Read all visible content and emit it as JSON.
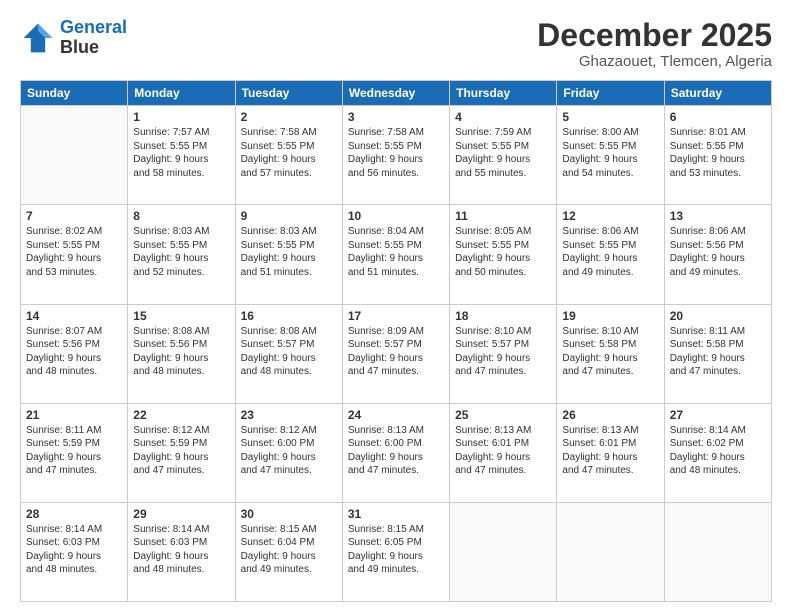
{
  "header": {
    "logo_line1": "General",
    "logo_line2": "Blue",
    "month": "December 2025",
    "location": "Ghazaouet, Tlemcen, Algeria"
  },
  "days_of_week": [
    "Sunday",
    "Monday",
    "Tuesday",
    "Wednesday",
    "Thursday",
    "Friday",
    "Saturday"
  ],
  "weeks": [
    [
      {
        "day": "",
        "info": ""
      },
      {
        "day": "1",
        "info": "Sunrise: 7:57 AM\nSunset: 5:55 PM\nDaylight: 9 hours\nand 58 minutes."
      },
      {
        "day": "2",
        "info": "Sunrise: 7:58 AM\nSunset: 5:55 PM\nDaylight: 9 hours\nand 57 minutes."
      },
      {
        "day": "3",
        "info": "Sunrise: 7:58 AM\nSunset: 5:55 PM\nDaylight: 9 hours\nand 56 minutes."
      },
      {
        "day": "4",
        "info": "Sunrise: 7:59 AM\nSunset: 5:55 PM\nDaylight: 9 hours\nand 55 minutes."
      },
      {
        "day": "5",
        "info": "Sunrise: 8:00 AM\nSunset: 5:55 PM\nDaylight: 9 hours\nand 54 minutes."
      },
      {
        "day": "6",
        "info": "Sunrise: 8:01 AM\nSunset: 5:55 PM\nDaylight: 9 hours\nand 53 minutes."
      }
    ],
    [
      {
        "day": "7",
        "info": "Sunrise: 8:02 AM\nSunset: 5:55 PM\nDaylight: 9 hours\nand 53 minutes."
      },
      {
        "day": "8",
        "info": "Sunrise: 8:03 AM\nSunset: 5:55 PM\nDaylight: 9 hours\nand 52 minutes."
      },
      {
        "day": "9",
        "info": "Sunrise: 8:03 AM\nSunset: 5:55 PM\nDaylight: 9 hours\nand 51 minutes."
      },
      {
        "day": "10",
        "info": "Sunrise: 8:04 AM\nSunset: 5:55 PM\nDaylight: 9 hours\nand 51 minutes."
      },
      {
        "day": "11",
        "info": "Sunrise: 8:05 AM\nSunset: 5:55 PM\nDaylight: 9 hours\nand 50 minutes."
      },
      {
        "day": "12",
        "info": "Sunrise: 8:06 AM\nSunset: 5:55 PM\nDaylight: 9 hours\nand 49 minutes."
      },
      {
        "day": "13",
        "info": "Sunrise: 8:06 AM\nSunset: 5:56 PM\nDaylight: 9 hours\nand 49 minutes."
      }
    ],
    [
      {
        "day": "14",
        "info": "Sunrise: 8:07 AM\nSunset: 5:56 PM\nDaylight: 9 hours\nand 48 minutes."
      },
      {
        "day": "15",
        "info": "Sunrise: 8:08 AM\nSunset: 5:56 PM\nDaylight: 9 hours\nand 48 minutes."
      },
      {
        "day": "16",
        "info": "Sunrise: 8:08 AM\nSunset: 5:57 PM\nDaylight: 9 hours\nand 48 minutes."
      },
      {
        "day": "17",
        "info": "Sunrise: 8:09 AM\nSunset: 5:57 PM\nDaylight: 9 hours\nand 47 minutes."
      },
      {
        "day": "18",
        "info": "Sunrise: 8:10 AM\nSunset: 5:57 PM\nDaylight: 9 hours\nand 47 minutes."
      },
      {
        "day": "19",
        "info": "Sunrise: 8:10 AM\nSunset: 5:58 PM\nDaylight: 9 hours\nand 47 minutes."
      },
      {
        "day": "20",
        "info": "Sunrise: 8:11 AM\nSunset: 5:58 PM\nDaylight: 9 hours\nand 47 minutes."
      }
    ],
    [
      {
        "day": "21",
        "info": "Sunrise: 8:11 AM\nSunset: 5:59 PM\nDaylight: 9 hours\nand 47 minutes."
      },
      {
        "day": "22",
        "info": "Sunrise: 8:12 AM\nSunset: 5:59 PM\nDaylight: 9 hours\nand 47 minutes."
      },
      {
        "day": "23",
        "info": "Sunrise: 8:12 AM\nSunset: 6:00 PM\nDaylight: 9 hours\nand 47 minutes."
      },
      {
        "day": "24",
        "info": "Sunrise: 8:13 AM\nSunset: 6:00 PM\nDaylight: 9 hours\nand 47 minutes."
      },
      {
        "day": "25",
        "info": "Sunrise: 8:13 AM\nSunset: 6:01 PM\nDaylight: 9 hours\nand 47 minutes."
      },
      {
        "day": "26",
        "info": "Sunrise: 8:13 AM\nSunset: 6:01 PM\nDaylight: 9 hours\nand 47 minutes."
      },
      {
        "day": "27",
        "info": "Sunrise: 8:14 AM\nSunset: 6:02 PM\nDaylight: 9 hours\nand 48 minutes."
      }
    ],
    [
      {
        "day": "28",
        "info": "Sunrise: 8:14 AM\nSunset: 6:03 PM\nDaylight: 9 hours\nand 48 minutes."
      },
      {
        "day": "29",
        "info": "Sunrise: 8:14 AM\nSunset: 6:03 PM\nDaylight: 9 hours\nand 48 minutes."
      },
      {
        "day": "30",
        "info": "Sunrise: 8:15 AM\nSunset: 6:04 PM\nDaylight: 9 hours\nand 49 minutes."
      },
      {
        "day": "31",
        "info": "Sunrise: 8:15 AM\nSunset: 6:05 PM\nDaylight: 9 hours\nand 49 minutes."
      },
      {
        "day": "",
        "info": ""
      },
      {
        "day": "",
        "info": ""
      },
      {
        "day": "",
        "info": ""
      }
    ]
  ]
}
